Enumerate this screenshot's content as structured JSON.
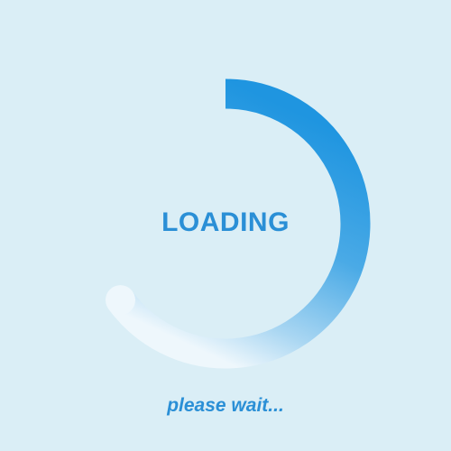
{
  "loader": {
    "title": "LOADING",
    "subtitle": "please wait...",
    "progress_fraction": 0.65,
    "colors": {
      "background": "#daeef6",
      "accent": "#2a8fd6",
      "arc_start": "#1f95e0",
      "arc_end": "#eef7fc"
    }
  }
}
